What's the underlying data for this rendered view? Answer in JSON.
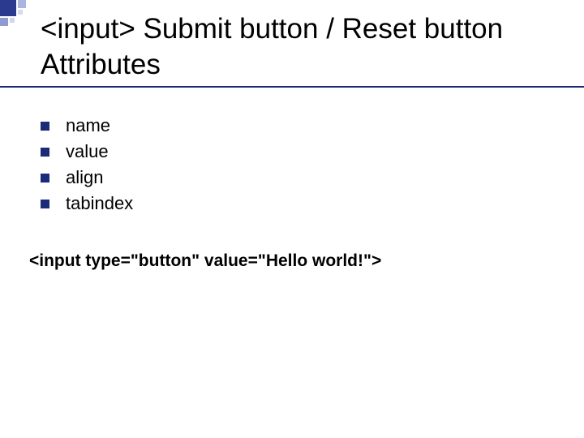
{
  "title": "<input> Submit button / Reset button Attributes",
  "bullets": [
    {
      "label": "name"
    },
    {
      "label": "value"
    },
    {
      "label": "align"
    },
    {
      "label": "tabindex"
    }
  ],
  "code_example": "<input type=\"button\" value=\"Hello world!\">"
}
